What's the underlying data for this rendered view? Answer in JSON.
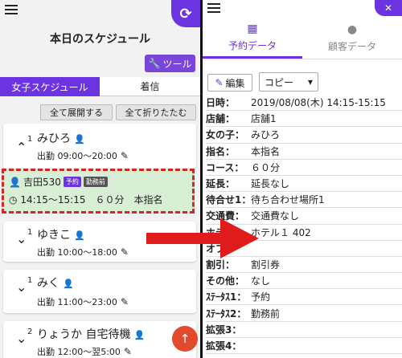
{
  "left": {
    "title": "本日のスケジュール",
    "tool_button": "ツール",
    "tabs": [
      "女子スケジュール",
      "着信"
    ],
    "expand_all": "全て展開する",
    "collapse_all": "全て折りたたむ",
    "cards": [
      {
        "num": "1",
        "name": "みひろ",
        "work": "出勤 09:00〜20:00"
      },
      {
        "num": "1",
        "name": "ゆきこ",
        "work": "出勤 10:00〜18:00"
      },
      {
        "num": "1",
        "name": "みく",
        "work": "出勤 11:00〜23:00"
      },
      {
        "num": "2",
        "name": "りょうか 自宅待機",
        "work": "出勤 12:00〜翌5:00"
      }
    ],
    "booking": {
      "customer": "吉田530",
      "badge1": "予約",
      "badge2": "勤務前",
      "time": "14:15〜15:15　６０分　本指名"
    }
  },
  "right": {
    "tabs": [
      "予約データ",
      "顧客データ"
    ],
    "edit_button": "編集",
    "copy_select": "コピー",
    "rows": [
      {
        "label": "日時：",
        "value": "2019/08/08(木) 14:15-15:15"
      },
      {
        "label": "店舗：",
        "value": "店舗1"
      },
      {
        "label": "女の子：",
        "value": "みひろ"
      },
      {
        "label": "指名：",
        "value": "本指名"
      },
      {
        "label": "コース：",
        "value": "６０分"
      },
      {
        "label": "延長：",
        "value": "延長なし"
      },
      {
        "label": "待合せ1：",
        "value": "待ち合わせ場所1"
      },
      {
        "label": "交通費：",
        "value": "交通費なし"
      },
      {
        "label": "ホテル：",
        "value": "ホテル１ 402"
      },
      {
        "label": "オプ：",
        "value": ""
      },
      {
        "label": "割引：",
        "value": "割引券"
      },
      {
        "label": "その他：",
        "value": "なし"
      },
      {
        "label": "ｽﾃｰﾀｽ1：",
        "value": "予約"
      },
      {
        "label": "ｽﾃｰﾀｽ2：",
        "value": "勤務前"
      },
      {
        "label": "拡張3：",
        "value": ""
      },
      {
        "label": "拡張4：",
        "value": ""
      }
    ]
  },
  "colors": {
    "accent": "#6c33e0",
    "highlight_border": "#d32626",
    "arrow": "#e01b1b",
    "booking_bg": "#d9efd5"
  }
}
